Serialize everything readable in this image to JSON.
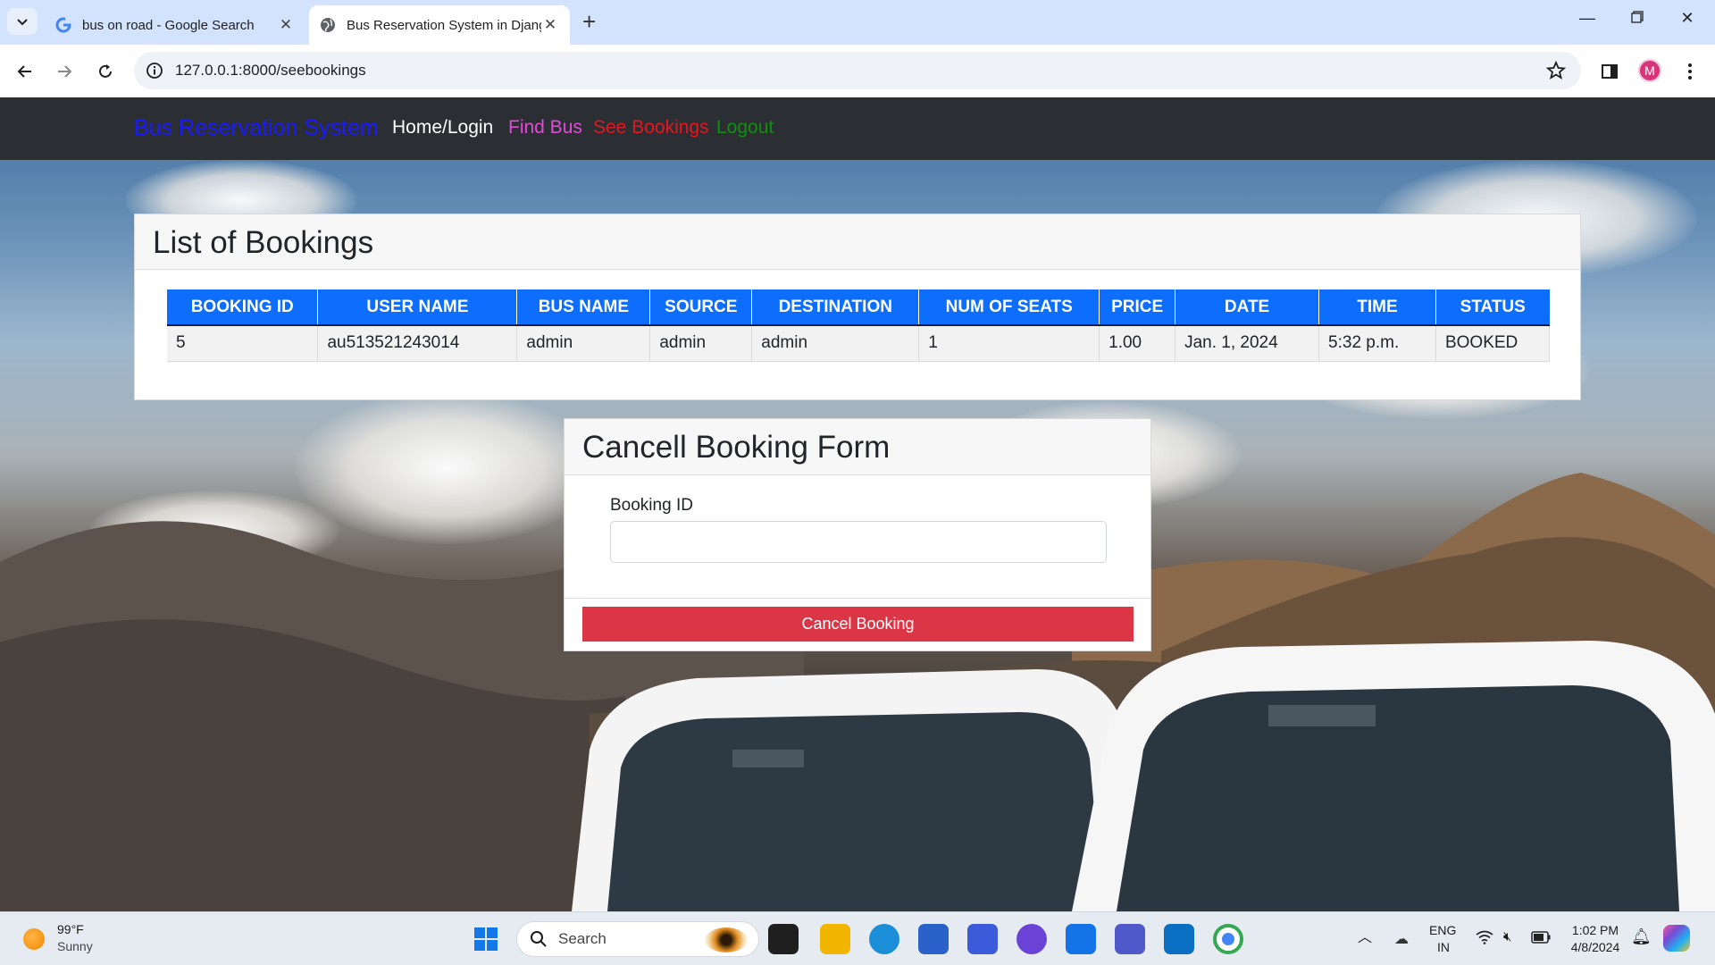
{
  "browser": {
    "tabs": [
      {
        "title": "bus on road - Google Search",
        "active": false
      },
      {
        "title": "Bus Reservation System in Django",
        "active": true
      }
    ],
    "url": "127.0.0.1:8000/seebookings",
    "profile_initial": "M"
  },
  "navbar": {
    "brand": "Bus Reservation System",
    "links": [
      {
        "label": "Home/Login",
        "color": "#ffffff"
      },
      {
        "label": "Find Bus",
        "color": "#e24bd8"
      },
      {
        "label": "See Bookings",
        "color": "#e8151e"
      },
      {
        "label": "Logout",
        "color": "#128d12"
      }
    ]
  },
  "bookings": {
    "title": "List of Bookings",
    "columns": [
      "BOOKING ID",
      "USER NAME",
      "BUS NAME",
      "SOURCE",
      "DESTINATION",
      "NUM OF SEATS",
      "PRICE",
      "DATE",
      "TIME",
      "STATUS"
    ],
    "rows": [
      [
        "5",
        "au513521243014",
        "admin",
        "admin",
        "admin",
        "1",
        "1.00",
        "Jan. 1, 2024",
        "5:32 p.m.",
        "BOOKED"
      ]
    ]
  },
  "cancel_form": {
    "title": "Cancell Booking Form",
    "booking_id_label": "Booking ID",
    "booking_id_value": "",
    "submit_label": "Cancel Booking"
  },
  "taskbar": {
    "weather_temp": "99°F",
    "weather_desc": "Sunny",
    "search_placeholder": "Search",
    "lang_top": "ENG",
    "lang_bottom": "IN",
    "time": "1:02 PM",
    "date": "4/8/2024"
  },
  "colors": {
    "navbar_bg": "#2b2f33",
    "brand": "#1a1aff",
    "table_header": "#0d6efd",
    "danger": "#dc3545"
  }
}
